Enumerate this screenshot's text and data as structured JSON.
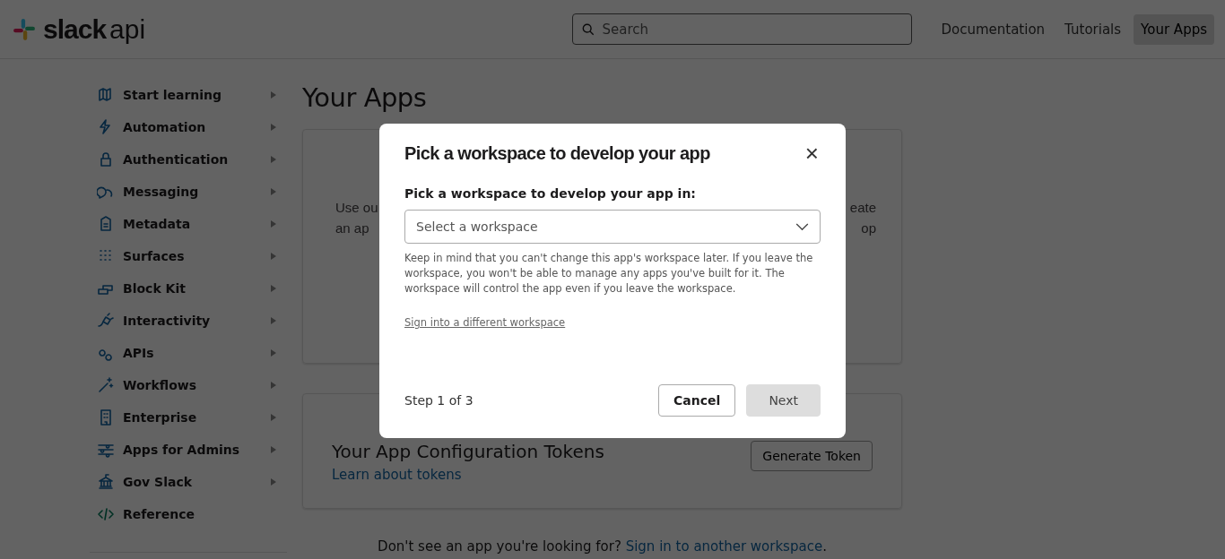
{
  "header": {
    "logo_word": "slack",
    "logo_suffix": "api",
    "search": {
      "placeholder": "Search"
    },
    "nav": [
      {
        "label": "Documentation",
        "selected": false
      },
      {
        "label": "Tutorials",
        "selected": false
      },
      {
        "label": "Your Apps",
        "selected": true
      }
    ]
  },
  "sidebar": {
    "items": [
      {
        "label": "Start learning",
        "expandable": true
      },
      {
        "label": "Automation",
        "expandable": true
      },
      {
        "label": "Authentication",
        "expandable": true
      },
      {
        "label": "Messaging",
        "expandable": true
      },
      {
        "label": "Metadata",
        "expandable": true
      },
      {
        "label": "Surfaces",
        "expandable": true
      },
      {
        "label": "Block Kit",
        "expandable": true
      },
      {
        "label": "Interactivity",
        "expandable": true
      },
      {
        "label": "APIs",
        "expandable": true
      },
      {
        "label": "Workflows",
        "expandable": true
      },
      {
        "label": "Enterprise",
        "expandable": true
      },
      {
        "label": "Apps for Admins",
        "expandable": true
      },
      {
        "label": "Gov Slack",
        "expandable": true
      },
      {
        "label": "Reference",
        "expandable": false
      }
    ]
  },
  "main": {
    "title": "Your Apps",
    "intro_card": {
      "left_lines": [
        "Use ou",
        "an ap"
      ],
      "right_lines": [
        "eate",
        "op"
      ]
    },
    "tokens_card": {
      "title": "Your App Configuration Tokens",
      "link": "Learn about tokens",
      "button": "Generate Token"
    },
    "footer": {
      "text": "Don't see an app you're looking for? ",
      "link": "Sign in to another workspace",
      "after": "."
    }
  },
  "dialog": {
    "title": "Pick a workspace to develop your app",
    "close": "×",
    "field_label": "Pick a workspace to develop your app in:",
    "select": {
      "placeholder": "Select a workspace"
    },
    "help": "Keep in mind that you can't change this app's workspace later. If you leave the workspace, you won't be able to manage any apps you've built for it. The workspace will control the app even if you leave the workspace.",
    "alt_link": "Sign into a different workspace",
    "step": "Step 1 of 3",
    "buttons": [
      {
        "label": "Cancel",
        "disabled": false
      },
      {
        "label": "Next",
        "disabled": true
      }
    ]
  }
}
